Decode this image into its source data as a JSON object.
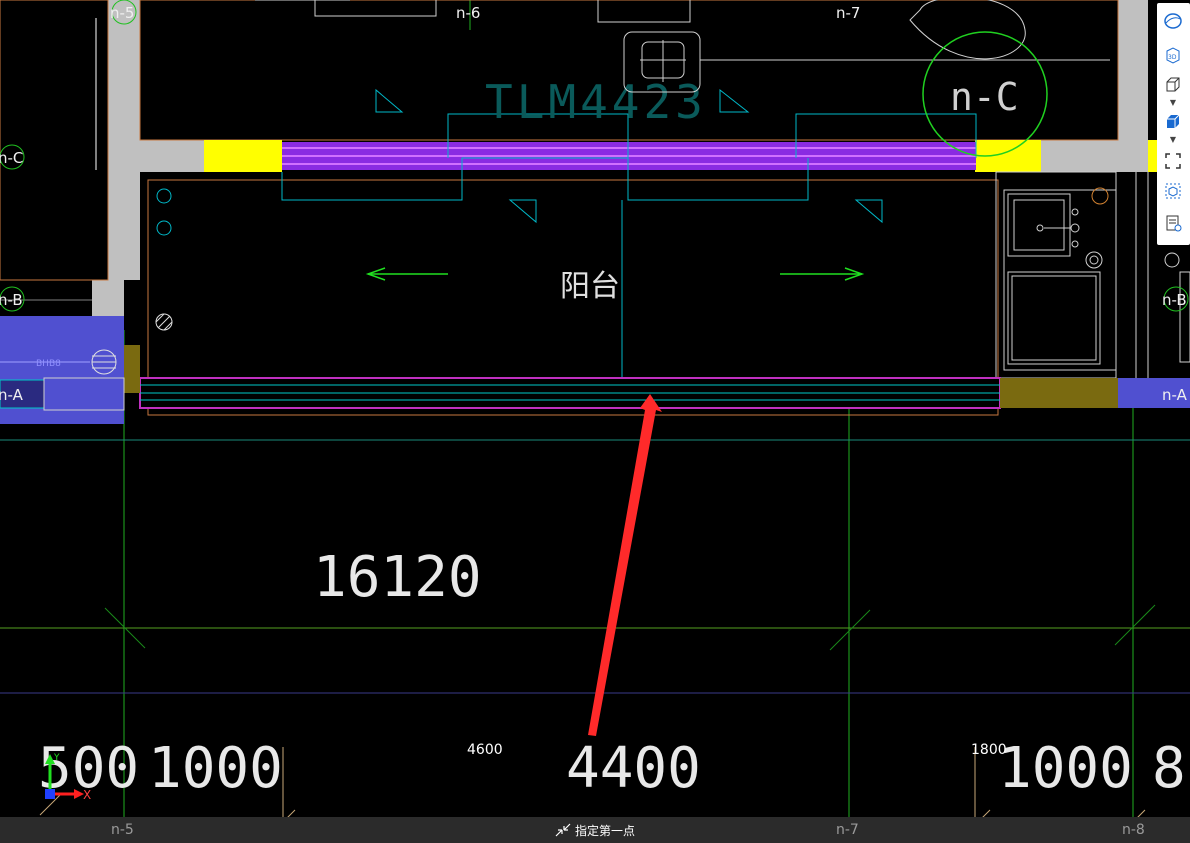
{
  "drawing": {
    "axis_labels_top": [
      "n-5",
      "n-6",
      "n-7"
    ],
    "axis_labels_left": [
      "n-C",
      "n-B",
      "n-A"
    ],
    "axis_labels_right": [
      "n-B",
      "n-A"
    ],
    "window_tag": "TLM4423",
    "grid_bubble": "n-C",
    "room_label": "阳台",
    "total_dimension": "16120",
    "dimensions_bottom": [
      "500",
      "1000",
      "4400",
      "1000",
      "8"
    ],
    "small_dimensions": [
      "4600",
      "1800"
    ],
    "small_tag": "BHB8"
  },
  "ucs": {
    "x_label": "X",
    "y_label": "Y"
  },
  "statusbar": {
    "prompt": "指定第一点",
    "axis_labels": [
      "n-5",
      "n-7",
      "n-8"
    ]
  },
  "toolbar": {
    "items": [
      "sphere-view-icon",
      "3d-view-icon",
      "cube-view-icon",
      "solid-cube-icon",
      "fullscreen-icon",
      "component-view-icon",
      "document-view-icon"
    ]
  },
  "colors": {
    "background": "#000000",
    "wall_gray": "#c0c0c0",
    "window_purple": "#8a2be2",
    "highlight_yellow": "#ffff00",
    "cyan_line": "#00c8c8",
    "green_axis": "#00c000",
    "annotation_red": "#ff2a2a"
  }
}
